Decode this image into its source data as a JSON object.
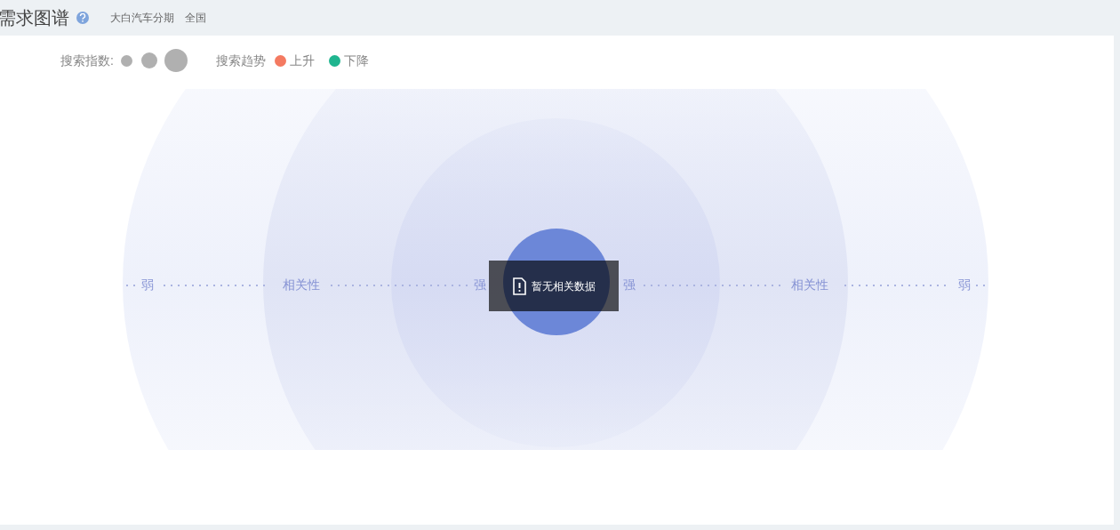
{
  "header": {
    "title": "需求图谱",
    "keyword": "大白汽车分期",
    "region": "全国"
  },
  "legend": {
    "index_label": "搜索指数:",
    "trend_label": "搜索趋势",
    "trends": [
      {
        "label": "上升",
        "color": "#f47a61"
      },
      {
        "label": "下降",
        "color": "#1fb58f"
      }
    ]
  },
  "chart": {
    "axis_labels": [
      "弱",
      "相关性",
      "强",
      "强",
      "相关性",
      "弱"
    ],
    "empty_message": "暂无相关数据"
  }
}
